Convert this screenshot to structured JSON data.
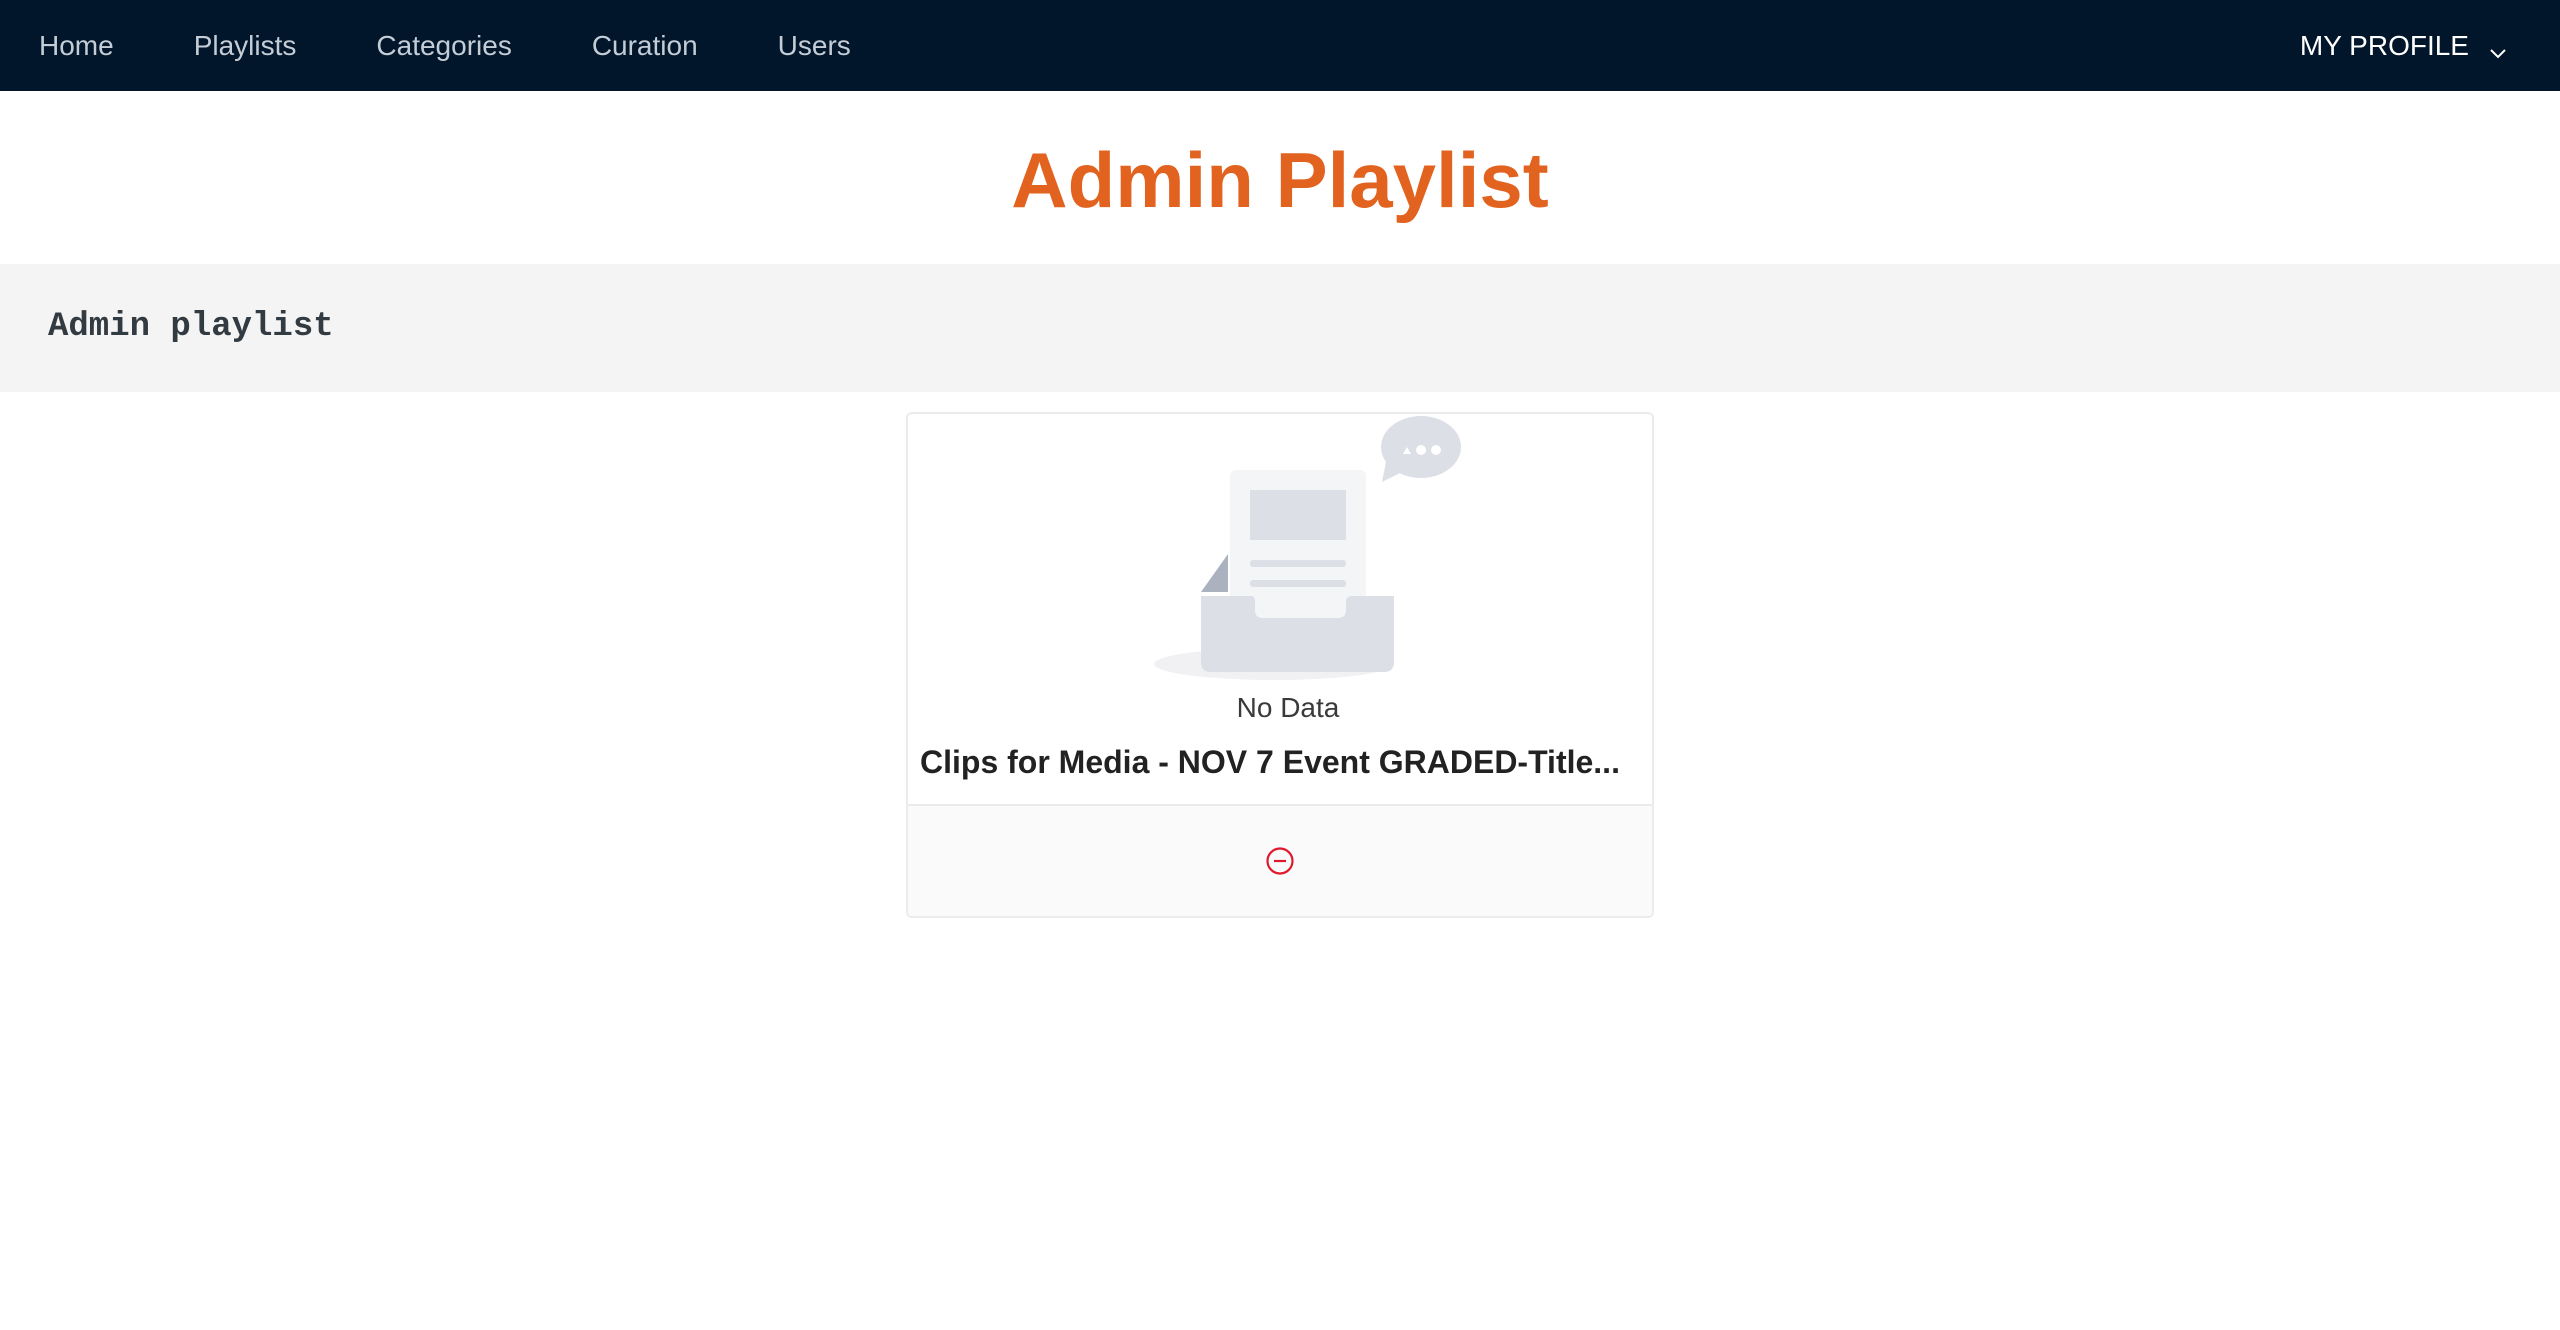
{
  "nav": {
    "items": [
      {
        "label": "Home"
      },
      {
        "label": "Playlists"
      },
      {
        "label": "Categories"
      },
      {
        "label": "Curation"
      },
      {
        "label": "Users"
      }
    ],
    "profile_label": "MY PROFILE"
  },
  "page": {
    "title": "Admin Playlist"
  },
  "section": {
    "title": "Admin playlist"
  },
  "card": {
    "empty_text": "No Data",
    "title": "Clips for Media - NOV 7 Event GRADED-Title..."
  },
  "colors": {
    "topbar": "#01162a",
    "title_accent": "#e2621f",
    "remove_icon": "#e0182d"
  },
  "icons": {
    "profile_caret": "chevron-down-icon",
    "empty": "empty-inbox-icon",
    "remove": "minus-circle-icon"
  }
}
